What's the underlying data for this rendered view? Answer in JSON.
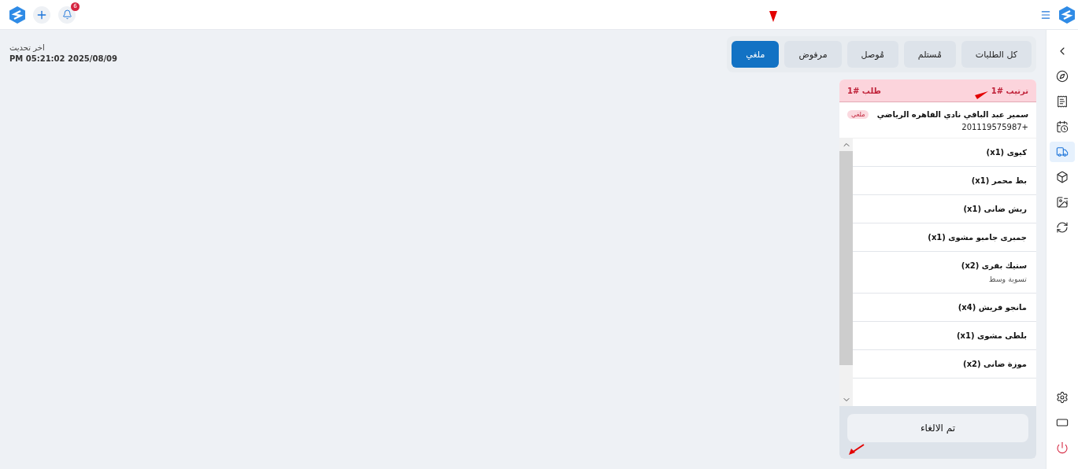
{
  "top_bar": {
    "notifications_count": "6"
  },
  "last_update": {
    "label": "اخر تحديث",
    "value": "PM 05:21:02 2025/08/09"
  },
  "tabs": [
    {
      "label": "كل الطلبات",
      "selected": false
    },
    {
      "label": "مُستلم",
      "selected": false
    },
    {
      "label": "مُوصل",
      "selected": false
    },
    {
      "label": "مرفوض",
      "selected": false
    },
    {
      "label": "ملغي",
      "selected": true
    }
  ],
  "order_card": {
    "sequence": "ترتيب #1",
    "order_number": "طلب #1",
    "customer_name": "سمير عبد الباقي نادي القاهره الرياضي",
    "phone": "201119575987+",
    "status_badge": "ملغي",
    "items": [
      {
        "name": "كيوى (x1)"
      },
      {
        "name": "بط محمر (x1)"
      },
      {
        "name": "ريش ضانى (x1)"
      },
      {
        "name": "جمبرى جامبو مشوى (x1)"
      },
      {
        "name": "ستيك بقرى (x2)",
        "note": "تسوية وسط"
      },
      {
        "name": "مانجو فريش (x4)"
      },
      {
        "name": "بلطى مشوى (x1)"
      },
      {
        "name": "موزة ضانى (x2)"
      }
    ],
    "status_button": "تم الالغاء"
  },
  "sidebar": {
    "items": [
      {
        "kind": "back",
        "selected": false
      },
      {
        "kind": "compass",
        "selected": false
      },
      {
        "kind": "receipt",
        "selected": false
      },
      {
        "kind": "clock",
        "selected": false
      },
      {
        "kind": "truck",
        "selected": true
      },
      {
        "kind": "box",
        "selected": false
      },
      {
        "kind": "image",
        "selected": false
      },
      {
        "kind": "refresh",
        "selected": false
      }
    ],
    "bottom_items": [
      {
        "kind": "settings"
      },
      {
        "kind": "screen"
      },
      {
        "kind": "power"
      }
    ]
  }
}
